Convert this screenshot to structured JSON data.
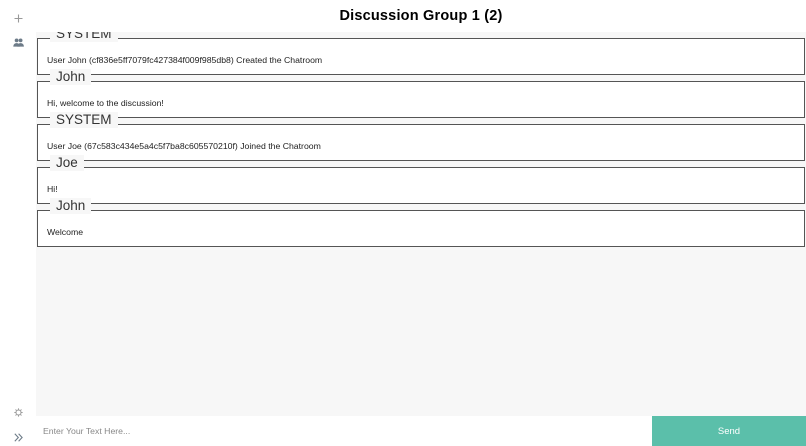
{
  "sidebar": {
    "icons": [
      {
        "name": "plus-icon"
      },
      {
        "name": "users-icon"
      },
      {
        "name": "gear-icon"
      },
      {
        "name": "double-chevron-right-icon"
      }
    ]
  },
  "header": {
    "title": "Discussion Group 1 (2)"
  },
  "messages": [
    {
      "sender": "SYSTEM",
      "text": "User John (cf836e5ff7079fc427384f009f985db8) Created the Chatroom"
    },
    {
      "sender": "John",
      "text": "Hi, welcome to the discussion!"
    },
    {
      "sender": "SYSTEM",
      "text": "User Joe (67c583c434e5a4c5f7ba8c605570210f) Joined the Chatroom"
    },
    {
      "sender": "Joe",
      "text": "Hi!"
    },
    {
      "sender": "John",
      "text": "Welcome"
    }
  ],
  "composer": {
    "placeholder": "Enter Your Text Here...",
    "value": "",
    "send_label": "Send"
  },
  "colors": {
    "send_button": "#5bbfaa",
    "chat_background": "#f7f7f7",
    "message_border": "#555555"
  }
}
